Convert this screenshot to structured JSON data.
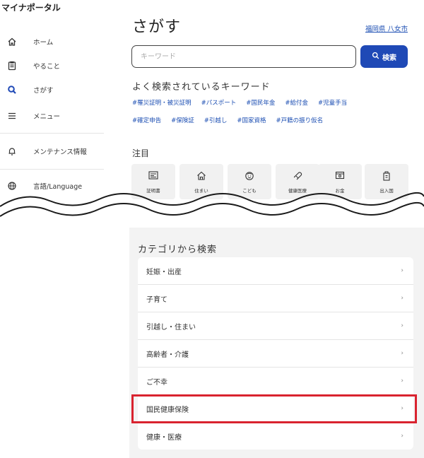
{
  "app": {
    "brand": "マイナポータル"
  },
  "sidebar": {
    "items": [
      {
        "label": "ホーム",
        "icon": "home-icon"
      },
      {
        "label": "やること",
        "icon": "todo-icon"
      },
      {
        "label": "さがす",
        "icon": "search-icon"
      },
      {
        "label": "メニュー",
        "icon": "menu-icon"
      },
      {
        "label": "メンテナンス情報",
        "icon": "bell-icon"
      },
      {
        "label": "言語/Language",
        "icon": "globe-icon"
      }
    ]
  },
  "main": {
    "title": "さがす",
    "region_link": "福岡県 八女市",
    "search": {
      "placeholder": "キーワード",
      "button_label": "検索"
    },
    "keywords_title": "よく検索されているキーワード",
    "keywords_row1": [
      "#罹災証明・被災証明",
      "#パスポート",
      "#国民年金",
      "#給付金",
      "#児童手当"
    ],
    "keywords_row2": [
      "#確定申告",
      "#保険証",
      "#引越し",
      "#国家資格",
      "#戸籍の振り仮名"
    ],
    "focus_title": "注目",
    "focus_tiles": [
      {
        "label": "証明書",
        "icon": "certificate-icon"
      },
      {
        "label": "住まい",
        "icon": "house-icon"
      },
      {
        "label": "こども",
        "icon": "child-icon"
      },
      {
        "label": "健康医療",
        "icon": "health-icon"
      },
      {
        "label": "お金",
        "icon": "money-icon"
      },
      {
        "label": "出入国",
        "icon": "passport-icon"
      }
    ],
    "category_title": "カテゴリから検索",
    "categories": [
      "妊娠・出産",
      "子育て",
      "引越し・住まい",
      "高齢者・介護",
      "ご不幸",
      "国民健康保険",
      "健康・医療"
    ],
    "highlight_color": "#d9232f",
    "accent_color": "#1f49b6"
  }
}
